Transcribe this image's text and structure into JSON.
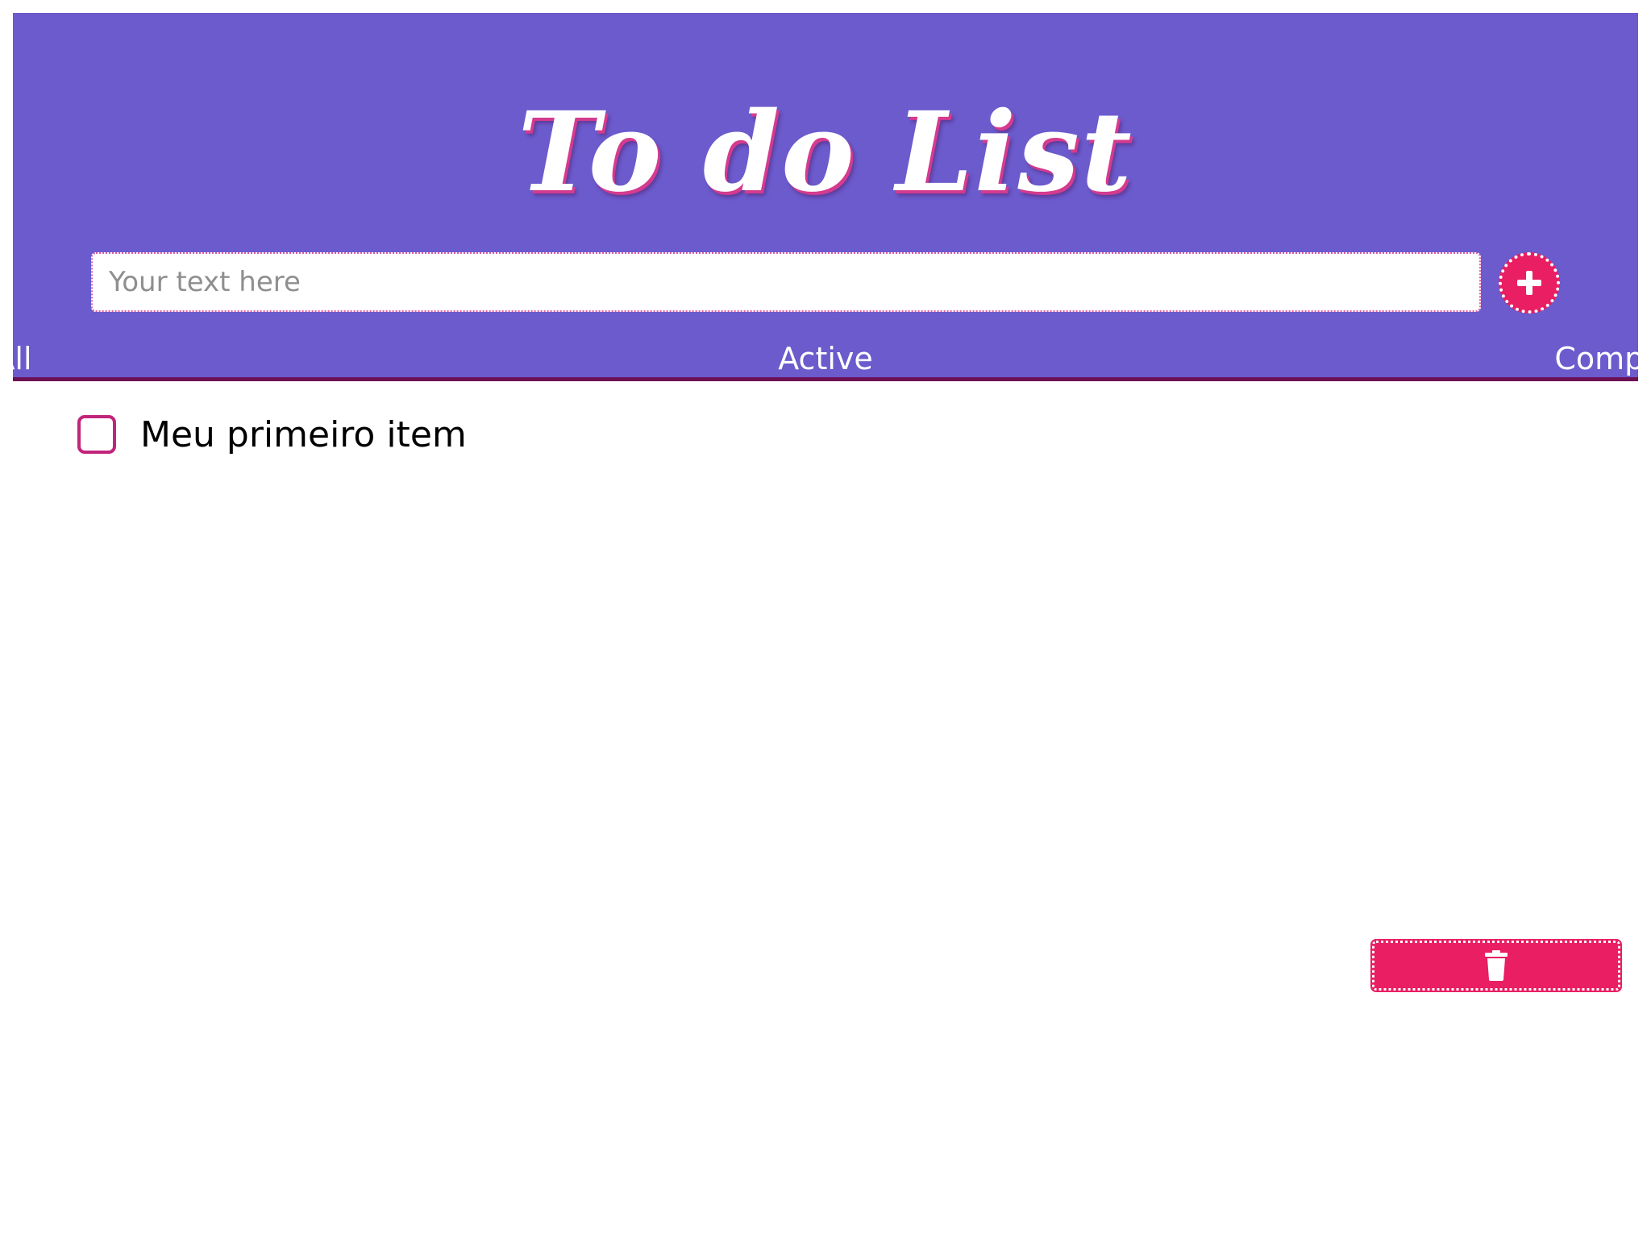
{
  "header": {
    "title": "To do List",
    "background_color": "#6b5bcd",
    "title_shadow_color": "#d43b8e"
  },
  "new_todo": {
    "placeholder": "Your text here",
    "value": "",
    "add_button_icon": "plus-icon",
    "add_button_color": "#e91e63"
  },
  "filters": {
    "tabs": [
      {
        "label": "All"
      },
      {
        "label": "Active"
      },
      {
        "label": "Completed"
      }
    ],
    "underline_color": "#6d1155"
  },
  "todos": [
    {
      "text": "Meu primeiro item",
      "completed": false
    }
  ],
  "actions": {
    "clear_icon": "trash-icon",
    "clear_button_color": "#e91e63"
  }
}
